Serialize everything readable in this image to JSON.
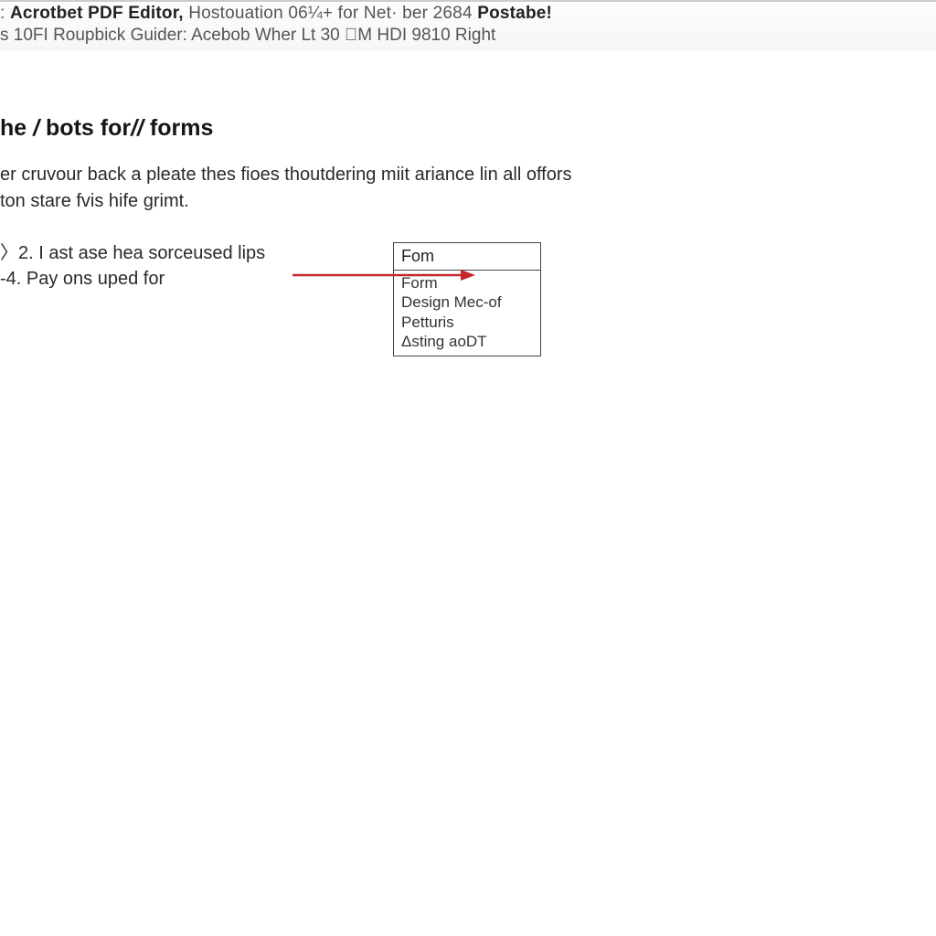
{
  "titlebar": {
    "line1_prefix": ": ",
    "line1_bold1": "Acrotbet PDF Editor,",
    "line1_mid": " Hostouation 06¼+ for Net· ber 2684 ",
    "line1_bold2": "Postabe!",
    "line2": "s 10FI Roupbick Guider: Acebob Wher Lt 30 ⃠M HDI 9810 Right"
  },
  "page": {
    "heading_a": "he ",
    "heading_slash1": "/",
    "heading_b": " bots for",
    "heading_slash2": "//",
    "heading_c": " forms",
    "para": "er cruvour back a pleate thes fioes thoutdering miit ariance lin all offors ton stare fvis hife grimt.",
    "list": {
      "item1": "〉2. I ast ase hea sorceused lips",
      "item2": "-4. Pay ons uped for"
    }
  },
  "dropdown": {
    "selected": "Fom",
    "options": [
      "Form",
      "Design Mec-of",
      "Petturis",
      "Δsting aoDT"
    ]
  },
  "colors": {
    "arrow": "#c1272d"
  }
}
